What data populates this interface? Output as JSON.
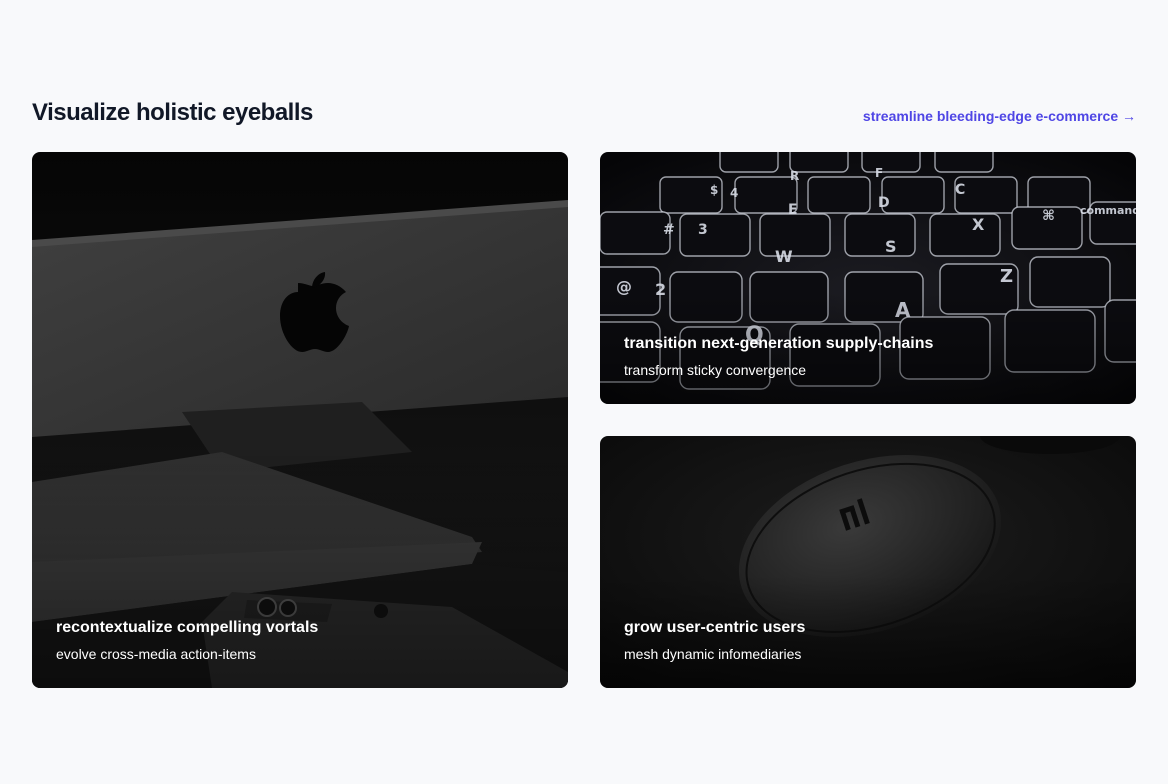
{
  "section": {
    "title": "Visualize holistic eyeballs",
    "see_all_label": "streamline bleeding-edge e-commerce →"
  },
  "cards": [
    {
      "title": "recontextualize compelling vortals",
      "subtitle": "evolve cross-media action-items",
      "image": "imac-and-iphone-photo"
    },
    {
      "title": "transition next-generation supply-chains",
      "subtitle": "transform sticky convergence",
      "image": "backlit-keyboard-photo"
    },
    {
      "title": "grow user-centric users",
      "subtitle": "mesh dynamic infomediaries",
      "image": "wireless-mouse-photo"
    }
  ],
  "keyboard": {
    "key_glyphs": [
      "@",
      "2",
      "Q",
      "W",
      "A",
      "S",
      "Z",
      "X",
      "#",
      "3",
      "E",
      "D",
      "F",
      "C",
      "$",
      "4",
      "R",
      "⌘",
      "command"
    ]
  },
  "colors": {
    "page_bg": "#f8f9fb",
    "title": "#111827",
    "accent": "#4f46e5",
    "caption_text": "#ffffff"
  }
}
